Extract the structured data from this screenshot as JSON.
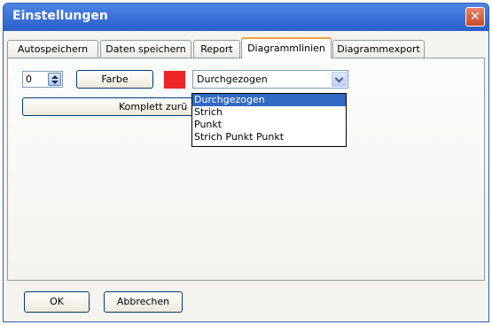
{
  "window": {
    "title": "Einstellungen",
    "close_label": "✕"
  },
  "tabs": [
    {
      "label": "Autospeichern"
    },
    {
      "label": "Daten speichern"
    },
    {
      "label": "Report"
    },
    {
      "label": "Diagrammlinien"
    },
    {
      "label": "Diagrammexport"
    }
  ],
  "active_tab": "Diagrammlinien",
  "line": {
    "index_value": "0",
    "color_button_label": "Farbe",
    "color": "#ee2424",
    "style_selected": "Durchgezogen",
    "style_options": [
      "Durchgezogen",
      "Strich",
      "Punkt",
      "Strich Punkt Punkt"
    ]
  },
  "reset_button_label": "Komplett zurü",
  "footer": {
    "ok_label": "OK",
    "cancel_label": "Abbrechen"
  },
  "icons": {
    "spin_up": "arrow-up-icon",
    "spin_down": "arrow-down-icon",
    "dropdown": "chevron-down-icon",
    "close": "close-icon"
  }
}
